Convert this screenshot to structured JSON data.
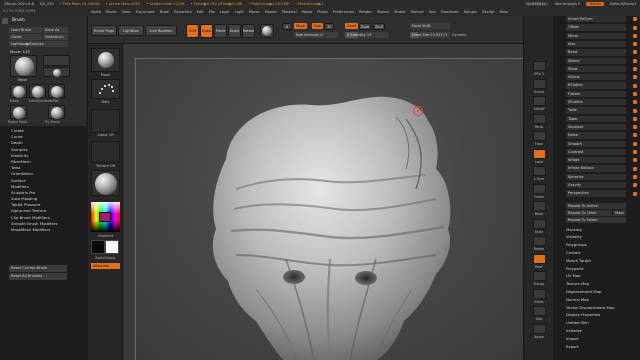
{
  "titlebar": {
    "app": "ZBrush 2021.6.6",
    "doc": "QS_230",
    "free_mem": "• Free Mem 10.536GB",
    "active_mem": "• Active Mem 4205",
    "scratch": "• Scratch Disk 11256",
    "timer": "• Timer▶0.052 ATime▶0.008",
    "polycount": "• PolyCount▶2.109 MP",
    "meshcount": "• MeshCount▶2",
    "quicksave": "QuickSave",
    "seethrough": "See-through 0",
    "menus": "Menus",
    "script": "DefaultZScript"
  },
  "menubar": [
    "Alpha",
    "Brush",
    "Color",
    "Document",
    "Draw",
    "Dynamics",
    "Edit",
    "File",
    "Layer",
    "Light",
    "Macro",
    "Marker",
    "Material",
    "Movie",
    "Picker",
    "Preferences",
    "Render",
    "Stencil",
    "Stroke",
    "Texture",
    "Tool",
    "Transform",
    "Zplugin",
    "Zscript",
    "Help"
  ],
  "coords": "0.276,-0.482,0.094",
  "brushpanel": {
    "title": "Brush",
    "load": "Load Brush",
    "saveas": "Save As",
    "clone": "Clone",
    "selecticon": "SelectIcon",
    "lightbox": "Lightbox▶Brushes",
    "move_label": "Move: 125",
    "item_move": "Move",
    "item_move2": "Move",
    "item_dam": "DamStandard",
    "item_inflat": "Inflat",
    "radial": "Radial Mask",
    "trybrush": "Try Brush"
  },
  "leftlist": [
    "Create",
    "Curve",
    "Depth",
    "Samples",
    "Elasticity",
    "FiberMesh",
    "Twist",
    "Orientation",
    "Surface",
    "Modifiers",
    "Sculptris Pro",
    "Auto Masking",
    "Tablet Pressure",
    "Alpha and Texture",
    "Clip Brush Modifiers",
    "Smooth Brush Modifiers",
    "MaskMesh Modifiers"
  ],
  "leftbuttons": {
    "reset_current": "Reset Current Brush",
    "reset_all": "Reset All Brushes"
  },
  "toolbar": {
    "homepage": "Home Page",
    "lightbox": "LightBox",
    "liveboolean": "Live Boolean",
    "edit": "Edit",
    "draw": "Draw",
    "move": "Move",
    "scale": "Scale",
    "rotate": "Rotate",
    "a": "A",
    "mrgb": "Mrgb",
    "rgb": "Rgb",
    "m": "M",
    "zadd": "Zadd",
    "zsub": "Zsub",
    "zcut": "Zcut",
    "rgb_intensity": "Rgb Intensity 0",
    "z_intensity": "Z Intensity 15",
    "focal_shift": "Focal Shift",
    "draw_size": "Draw Size 12.91171",
    "dynamic": "Dynamic",
    "activepoints": "ActivePoints: 2.1",
    "totalpoints": "TotalPoints: 4.21"
  },
  "shelf": {
    "move": "Move",
    "dots": "Dots",
    "alphaoff": "Alpha Off",
    "textureoff": "Texture Off",
    "gradient": "Gradient",
    "switchcolor": "SwitchColor",
    "alternate": "Alternate"
  },
  "rightshelf": [
    "SPix 3",
    "Actual",
    "AAHalf",
    "Persp",
    "Floor",
    "Local",
    "L.Sym",
    "Frame",
    "Move",
    "Scale",
    "Rotate",
    "PolyF",
    "Transp",
    "Ghost",
    "Solo",
    "Xpose"
  ],
  "rightpanel": {
    "top_labels": [
      "Smart ReSym",
      "Offset",
      "Mirror",
      "Size",
      "Bend",
      "SBend",
      "Skew",
      "SSkew",
      "RFlatten",
      "Flatten",
      "SFlatten",
      "Twist",
      "Taper",
      "Squeeze",
      "Noise",
      "Smooth",
      "Contrast",
      "Inflate",
      "Inflate Balloon",
      "Spherize",
      "Gravity",
      "Perspective"
    ],
    "repeat_active": "Repeat To Active",
    "repeat_other": "Repeat To Other",
    "mask": "Mask",
    "repeat_folder": "Repeat To Folder",
    "menu_items": [
      "Masking",
      "Visibility",
      "Polygroups",
      "Contact",
      "Morph Target",
      "Polypaint",
      "UV Map",
      "Texture Map",
      "Displacement Map",
      "Normal Map",
      "Vector Displacement Map",
      "Display Properties",
      "Unified Skin",
      "Initialize",
      "Import",
      "Export"
    ]
  },
  "colors": {
    "accent": "#e0701a",
    "panel": "#2d2d2d",
    "background": "#1e1e1e"
  }
}
